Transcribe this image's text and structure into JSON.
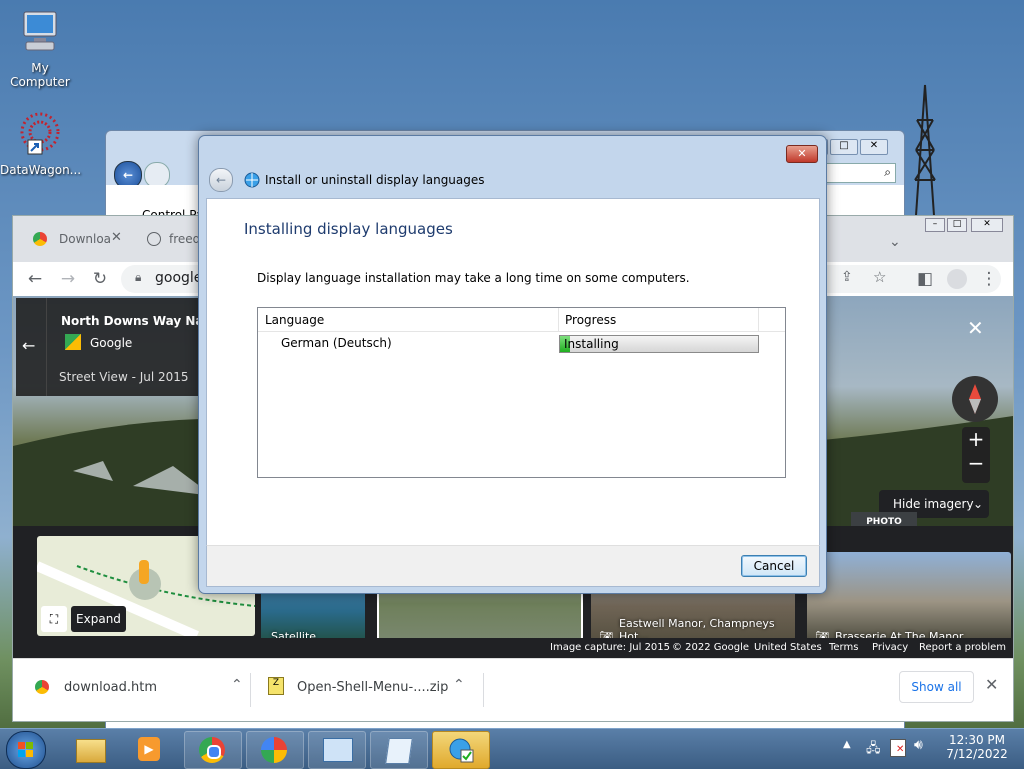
{
  "desktop": {
    "icons": [
      {
        "label": "My Computer"
      },
      {
        "label": "DataWagon..."
      }
    ]
  },
  "control_panel_window": {
    "address_fragment": "Control Pa"
  },
  "chrome": {
    "tabs": [
      {
        "label": "Downloa"
      },
      {
        "label": "freed"
      }
    ],
    "address_text": "google",
    "place": {
      "title": "North Downs Way Nationa",
      "provider": "Google",
      "subtitle": "Street View - Jul 2015"
    },
    "hide_imagery_label": "Hide imagery",
    "photo_badge": "PHOTO",
    "map_expand_label": "Expand",
    "thumbnails": [
      {
        "label": "Satellite"
      },
      {
        "label": ""
      },
      {
        "label": "Eastwell Manor, Champneys Hot..."
      },
      {
        "label": "Brasserie At The Manor"
      }
    ],
    "footer": {
      "capture": "Image capture: Jul 2015",
      "copyright": "© 2022 Google",
      "country": "United States",
      "terms": "Terms",
      "privacy": "Privacy",
      "report": "Report a problem"
    },
    "downloads": {
      "items": [
        {
          "name": "download.htm"
        },
        {
          "name": "Open-Shell-Menu-....zip"
        }
      ],
      "show_all_label": "Show all"
    }
  },
  "dialog": {
    "title": "Install or uninstall display languages",
    "heading": "Installing display languages",
    "note": "Display language installation may take a long time on some computers.",
    "columns": [
      "Language",
      "Progress"
    ],
    "rows": [
      {
        "language": "German (Deutsch)",
        "status": "Installing",
        "progress": 0.05
      }
    ],
    "cancel_label": "Cancel"
  },
  "taskbar": {
    "time": "12:30 PM",
    "date": "7/12/2022"
  },
  "colors": {
    "progress_green": "#1fae1f",
    "heading_blue": "#1e3b6e",
    "taskbar_active": "#e0a92d"
  }
}
